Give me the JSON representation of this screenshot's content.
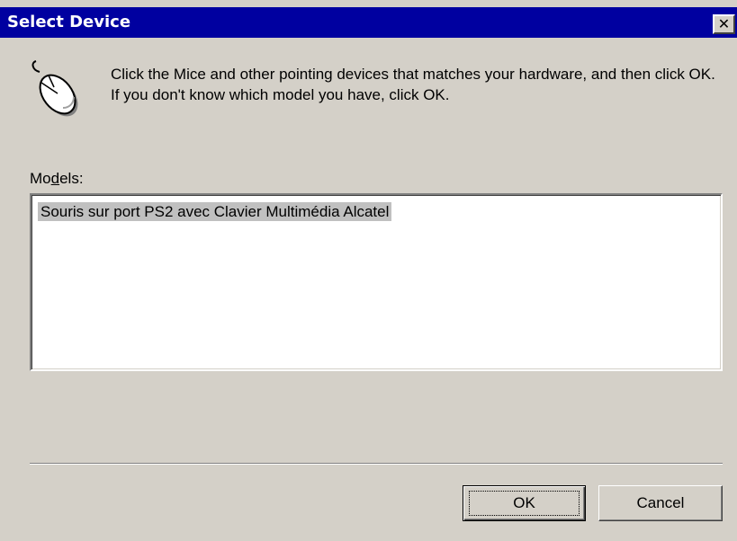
{
  "dialog": {
    "title": "Select Device",
    "close_label": "✕",
    "icon": "mouse-icon",
    "message": "Click the Mice and other pointing devices that matches your hardware, and then click OK. If you don't know which model you have, click OK.",
    "models_label_prefix": "Mo",
    "models_label_accel": "d",
    "models_label_suffix": "els:",
    "models": [
      {
        "label": "Souris sur port PS2 avec Clavier Multimédia Alcatel",
        "selected": true
      }
    ],
    "buttons": {
      "ok_label": "OK",
      "cancel_label": "Cancel"
    },
    "colors": {
      "titlebar": "#0000a0",
      "face": "#d4d0c8",
      "selection": "#c0c0c0"
    }
  }
}
